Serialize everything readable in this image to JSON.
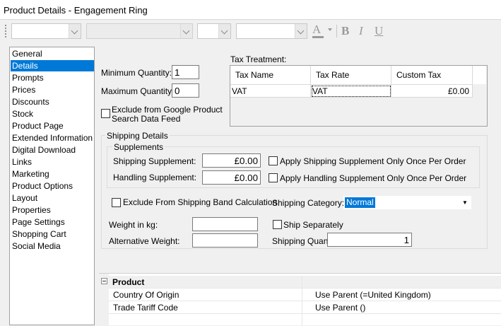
{
  "window": {
    "title": "Product Details - Engagement Ring"
  },
  "toolbar": {
    "font_color_icon": "A",
    "bold": "B",
    "italic": "I",
    "underline": "U"
  },
  "nav": {
    "items": [
      {
        "label": "General"
      },
      {
        "label": "Details",
        "selected": true
      },
      {
        "label": "Prompts"
      },
      {
        "label": "Prices"
      },
      {
        "label": "Discounts"
      },
      {
        "label": "Stock"
      },
      {
        "label": "Product Page"
      },
      {
        "label": "Extended Information"
      },
      {
        "label": "Digital Download"
      },
      {
        "label": "Links"
      },
      {
        "label": "Marketing"
      },
      {
        "label": "Product Options"
      },
      {
        "label": "Layout"
      },
      {
        "label": "Properties"
      },
      {
        "label": "Page Settings"
      },
      {
        "label": "Shopping Cart"
      },
      {
        "label": "Social Media"
      }
    ]
  },
  "details": {
    "min_qty_label": "Minimum Quantity:",
    "min_qty_value": "1",
    "max_qty_label": "Maximum Quantity:",
    "max_qty_value": "0",
    "exclude_google_label_1": "Exclude from Google Product",
    "exclude_google_label_2": "Search Data Feed",
    "exclude_google_checked": false
  },
  "tax": {
    "title": "Tax Treatment:",
    "columns": [
      "Tax Name",
      "Tax Rate",
      "Custom Tax"
    ],
    "rows": [
      {
        "name": "VAT",
        "rate": "VAT",
        "custom": "£0.00"
      }
    ]
  },
  "shipping": {
    "group_title": "Shipping Details",
    "supplements_title": "Supplements",
    "shipping_supp_label": "Shipping Supplement:",
    "shipping_supp_value": "£0.00",
    "apply_shipping_once_label": "Apply Shipping Supplement Only Once Per Order",
    "handling_supp_label": "Handling Supplement:",
    "handling_supp_value": "£0.00",
    "apply_handling_once_label": "Apply Handling Supplement Only Once Per Order",
    "exclude_band_label": "Exclude From Shipping Band Calculation",
    "category_label": "Shipping Category:",
    "category_value": "Normal",
    "weight_label": "Weight in kg:",
    "weight_value": "",
    "alt_weight_label": "Alternative Weight:",
    "alt_weight_value": "",
    "ship_separately_label": "Ship Separately",
    "quantity_label": "Shipping Quantity:",
    "quantity_value": "1"
  },
  "property_grid": {
    "category": "Product",
    "rows": [
      {
        "name": "Country Of Origin",
        "value": "Use Parent (=United Kingdom)"
      },
      {
        "name": "Trade Tariff Code",
        "value": "Use Parent ()"
      }
    ]
  }
}
